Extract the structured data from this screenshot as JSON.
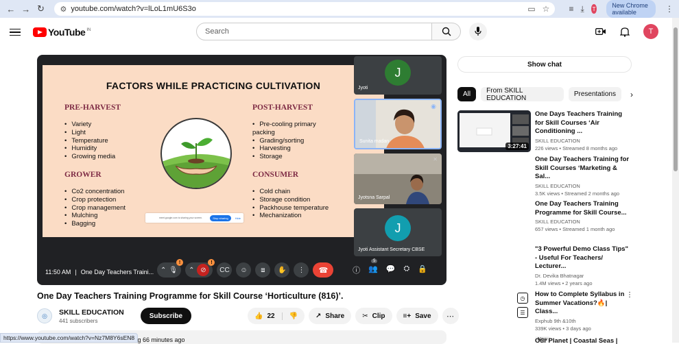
{
  "browser": {
    "url": "youtube.com/watch?v=lLoL1mU6S3o",
    "new_chrome_label": "New Chrome available",
    "profile_initial": "T",
    "status_url": "https://www.youtube.com/watch?v=Nz7M8Y6sEN8"
  },
  "header": {
    "logo_text": "YouTube",
    "logo_region": "IN",
    "search_placeholder": "Search",
    "user_initial": "T"
  },
  "slide": {
    "title": "FACTORS WHILE PRACTICING CULTIVATION",
    "pre_harvest": {
      "heading": "PRE-HARVEST",
      "items": [
        "Variety",
        "Light",
        "Temperature",
        "Humidity",
        "Growing media"
      ]
    },
    "grower": {
      "heading": "GROWER",
      "items": [
        "Co2 concentration",
        "Crop protection",
        "Crop management",
        "Mulching",
        "Bagging"
      ]
    },
    "post_harvest": {
      "heading": "POST-HARVEST",
      "items": [
        "Pre-cooling primary packing",
        "Grading/sorting",
        "Harvesting",
        "Storage"
      ]
    },
    "consumer": {
      "heading": "CONSUMER",
      "items": [
        "Cold chain",
        "Storage condition",
        "Packhouse temperature",
        "Mechanization"
      ]
    },
    "share_note": "meet.google.com is sharing your screen.",
    "stop_sharing": "Stop sharing",
    "hide": "Hide"
  },
  "participants": [
    {
      "name": "Jyoti",
      "initial": "J",
      "color": "#2e7d32"
    },
    {
      "name": "Sunita madan",
      "initial": "",
      "color": ""
    },
    {
      "name": "Jyotsna Sarpal",
      "initial": "",
      "color": ""
    },
    {
      "name": "Jyoti Assistant Secretary CBSE",
      "initial": "J",
      "color": "#129eaf"
    }
  ],
  "meet_controls": {
    "time": "11:50 AM",
    "separator": "|",
    "meeting_name": "One Day Teachers Traini...",
    "mic_badge": "!",
    "cam_badge": "!",
    "people_count": "5"
  },
  "video": {
    "title": "One Day Teachers Training Programme for Skill Course ‘Horticulture (816)’.",
    "channel": "SKILL EDUCATION",
    "subscribers": "441 subscribers",
    "subscribe_label": "Subscribe",
    "likes": "22",
    "share_label": "Share",
    "clip_label": "Clip",
    "save_label": "Save",
    "stream_text": "aming 66 minutes ago"
  },
  "sidebar": {
    "show_chat": "Show chat",
    "chips": [
      "All",
      "From SKILL EDUCATION",
      "Presentations"
    ],
    "recs": [
      {
        "title": "One Days Teachers Training for Skill Courses ‘Air Conditioning ...",
        "channel": "SKILL EDUCATION",
        "meta": "226 views • Streamed 8 months ago",
        "duration": "3:27:41"
      },
      {
        "title": "One Day Teachers Training for Skill Courses ‘Marketing & Sal...",
        "channel": "SKILL EDUCATION",
        "meta": "3.5K views • Streamed 2 months ago"
      },
      {
        "title": "One Day Teachers Training Programme for Skill Course...",
        "channel": "SKILL EDUCATION",
        "meta": "657 views • Streamed 1 month ago"
      },
      {
        "title": "\"3 Powerful Demo Class Tips\" - Useful For Teachers/ Lecturer...",
        "channel": "Dr. Devika Bhatnagar",
        "meta": "1.4M views • 2 years ago"
      },
      {
        "title": "How to Complete Syllabus in Summer Vacations?🔥| Class...",
        "channel": "Exphub 9th &10th",
        "meta": "339K views • 3 days ago",
        "badge": "New"
      },
      {
        "title": "Our Planet | Coastal Seas | FULL"
      }
    ]
  }
}
